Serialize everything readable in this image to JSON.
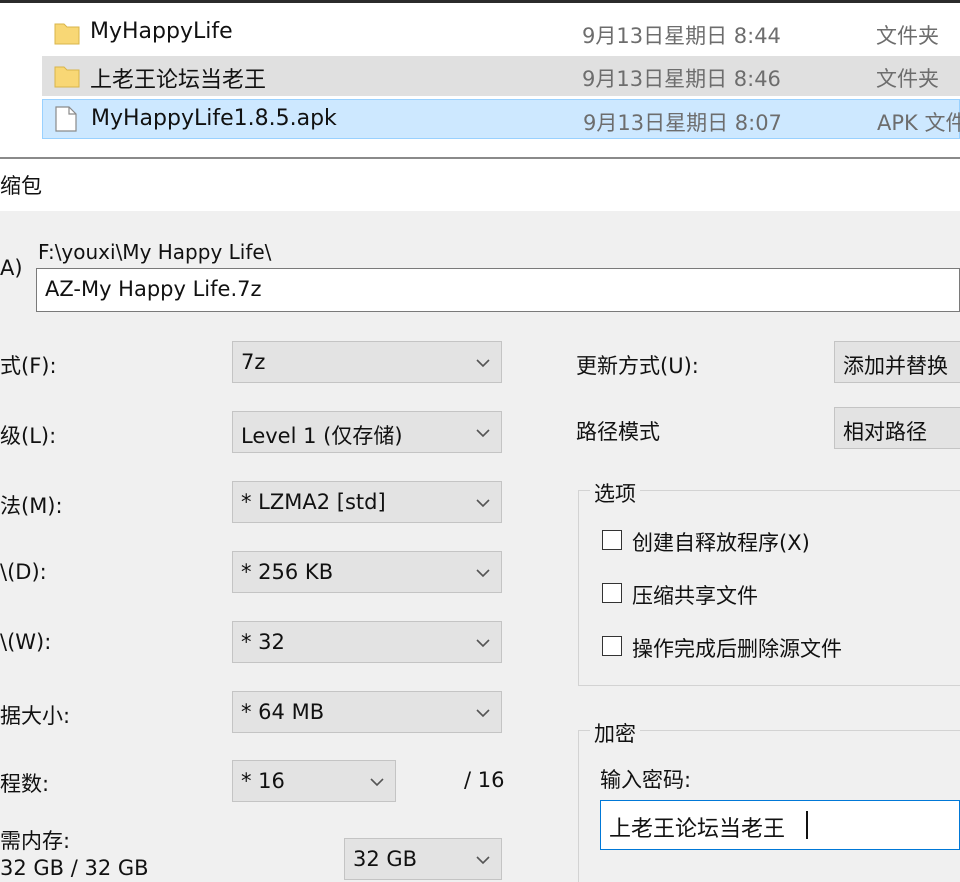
{
  "explorer": {
    "files": [
      {
        "name": "MyHappyLife",
        "date": "9月13日星期日 8:44",
        "type": "文件夹",
        "icon": "folder-icon"
      },
      {
        "name": "上老王论坛当老王",
        "date": "9月13日星期日 8:46",
        "type": "文件夹",
        "icon": "folder-icon"
      },
      {
        "name": "MyHappyLife1.8.5.apk",
        "date": "9月13日星期日 8:07",
        "type": "APK 文件",
        "icon": "file-icon"
      }
    ]
  },
  "dialog": {
    "title": "缩包",
    "archive_label": "A)",
    "path": "F:\\youxi\\My Happy Life\\",
    "archive_name": "AZ-My Happy Life.7z",
    "left_fields": [
      {
        "label": "式(F):",
        "value": "7z"
      },
      {
        "label": "级(L):",
        "value": "Level 1 (仅存储)"
      },
      {
        "label": "法(M):",
        "value": "* LZMA2 [std]"
      },
      {
        "label": "\\(D):",
        "value": "* 256 KB"
      },
      {
        "label": "\\(W):",
        "value": "* 32"
      },
      {
        "label": "据大小:",
        "value": "* 64 MB"
      }
    ],
    "threads": {
      "label": "程数:",
      "value": "* 16",
      "max": "/ 16"
    },
    "memory": {
      "label": "需内存:",
      "usage": "32 GB / 32 GB",
      "value": "32 GB"
    },
    "update_mode": {
      "label": "更新方式(U):",
      "value": "添加并替换"
    },
    "path_mode": {
      "label": "路径模式",
      "value": "相对路径"
    },
    "options": {
      "title": "选项",
      "items": [
        "创建自释放程序(X)",
        "压缩共享文件",
        "操作完成后删除源文件"
      ]
    },
    "encryption": {
      "title": "加密",
      "password_label": "输入密码:",
      "password_value": "上老王论坛当老王"
    }
  }
}
